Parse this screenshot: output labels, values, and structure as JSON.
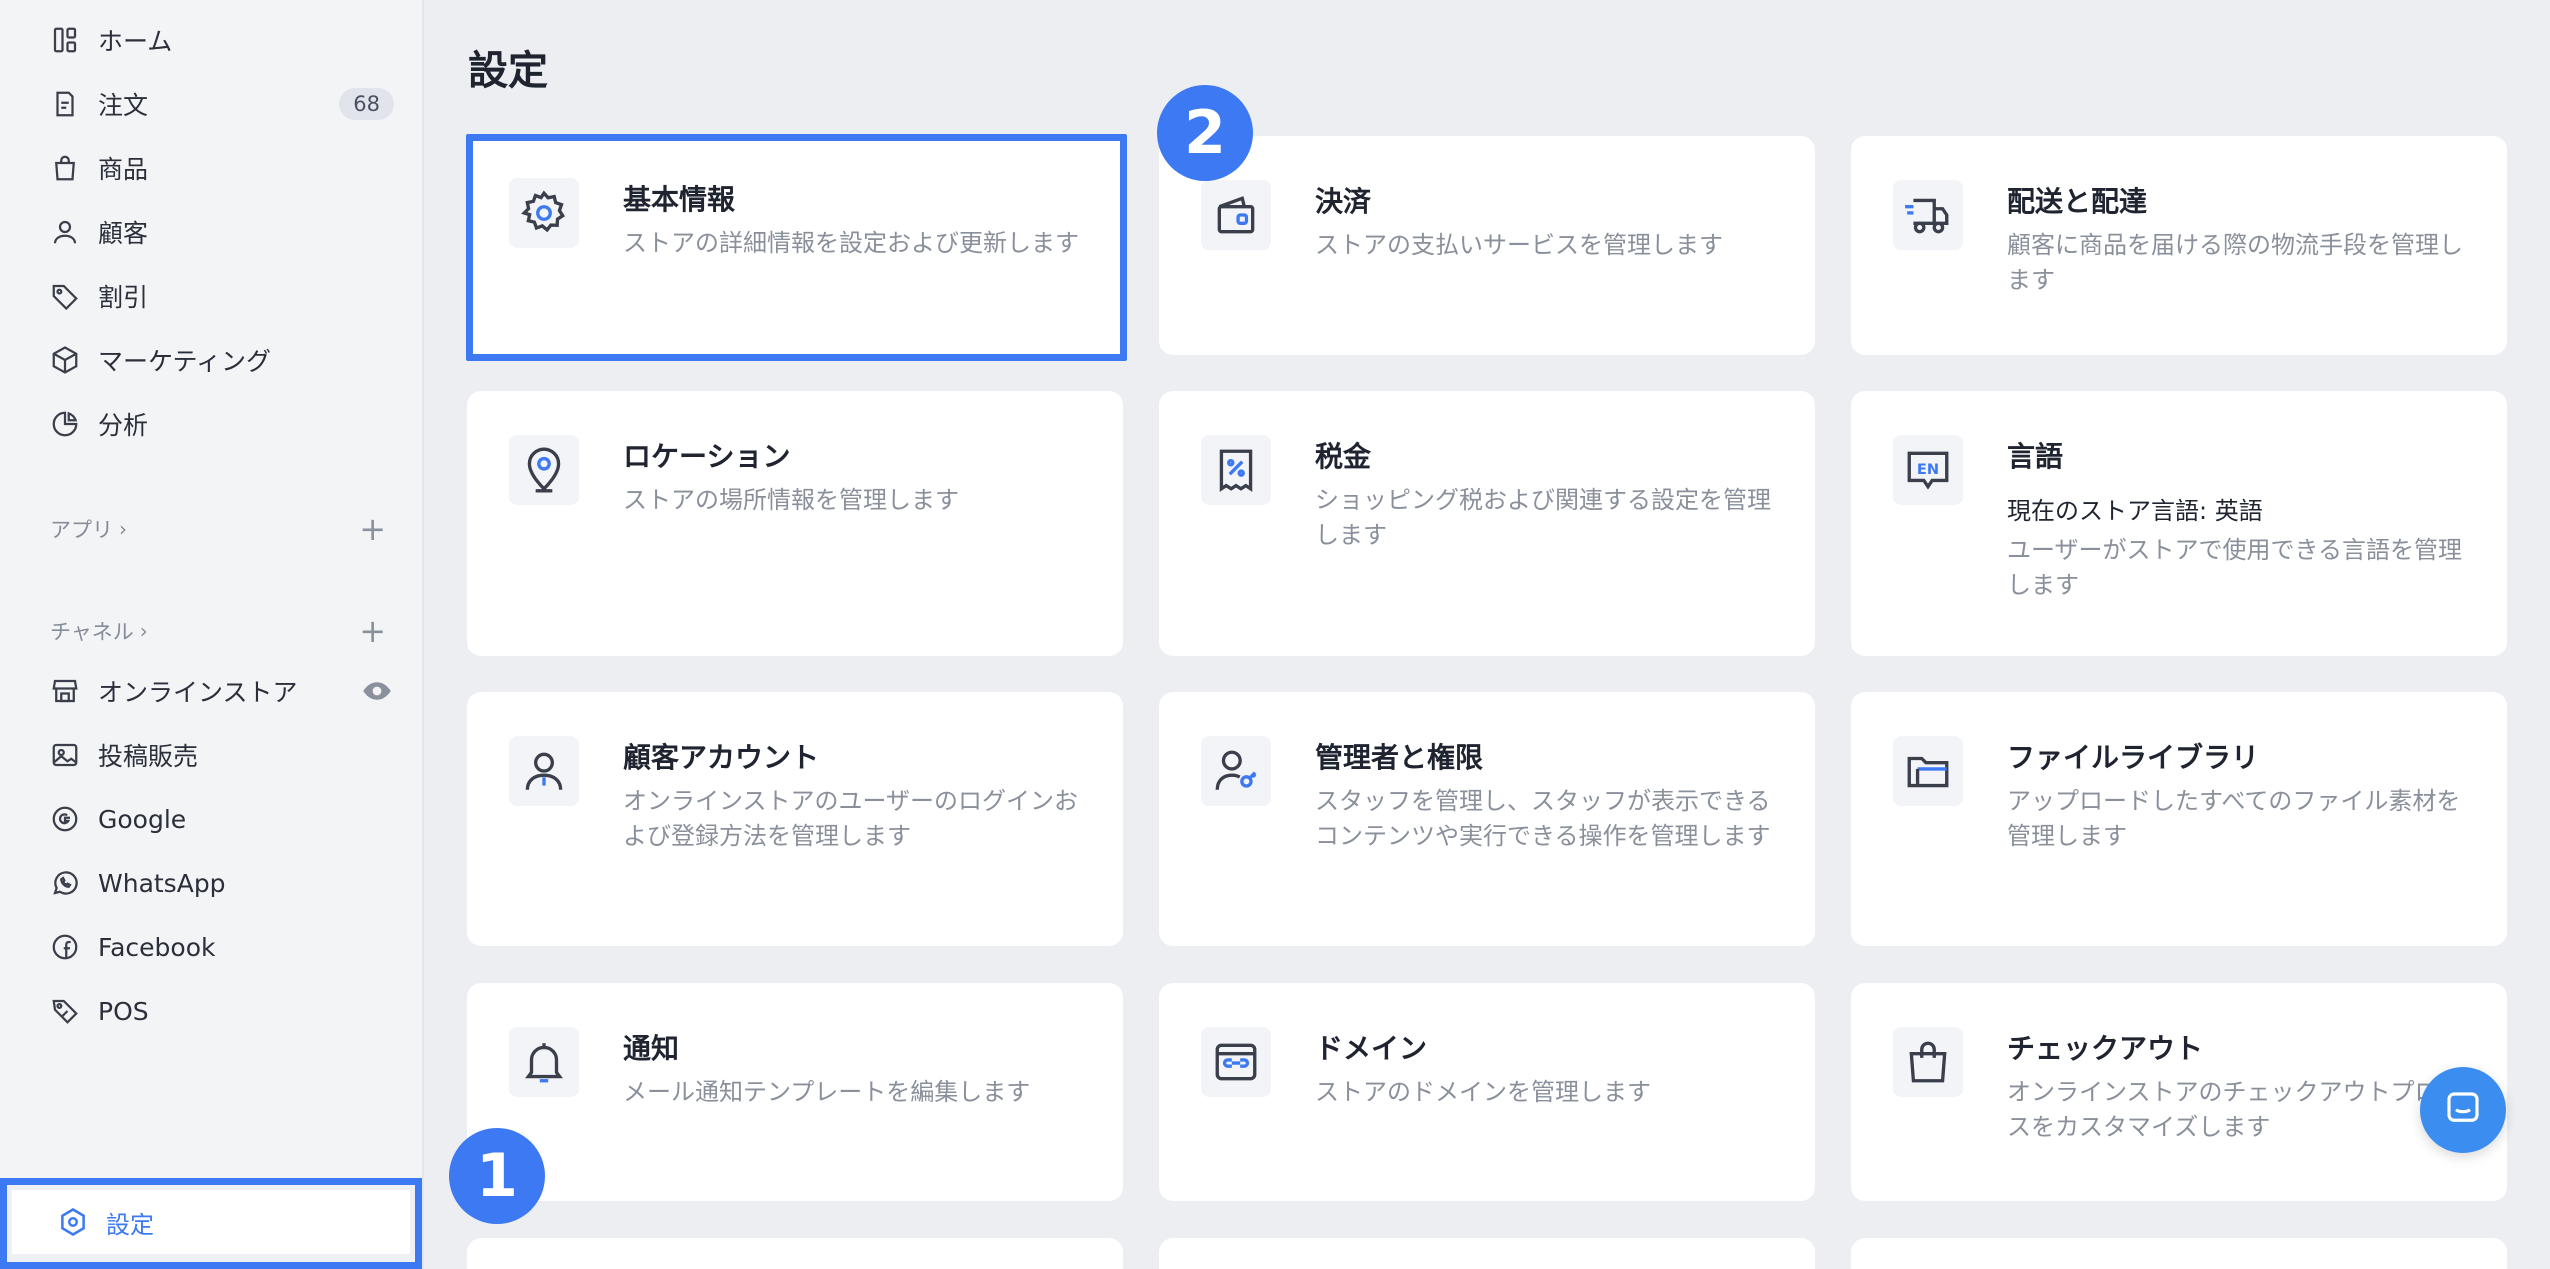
{
  "sidebar": {
    "items": [
      {
        "label": "ホーム",
        "icon": "home-icon"
      },
      {
        "label": "注文",
        "icon": "order-icon",
        "badge": "68"
      },
      {
        "label": "商品",
        "icon": "bag-icon"
      },
      {
        "label": "顧客",
        "icon": "user-icon"
      },
      {
        "label": "割引",
        "icon": "tag-icon"
      },
      {
        "label": "マーケティング",
        "icon": "cube-icon"
      },
      {
        "label": "分析",
        "icon": "pie-chart-icon"
      }
    ],
    "apps_label": "アプリ",
    "channels_label": "チャネル",
    "chevron": "›",
    "plus": "+",
    "channels": [
      {
        "label": "オンラインストア",
        "icon": "store-icon"
      },
      {
        "label": "投稿販売",
        "icon": "image-icon"
      },
      {
        "label": "Google",
        "icon": "google-icon"
      },
      {
        "label": "WhatsApp",
        "icon": "whatsapp-icon"
      },
      {
        "label": "Facebook",
        "icon": "facebook-icon"
      },
      {
        "label": "POS",
        "icon": "pos-icon"
      }
    ],
    "settings_label": "設定"
  },
  "main": {
    "title": "設定",
    "cards": [
      {
        "title": "基本情報",
        "desc": "ストアの詳細情報を設定および更新します",
        "icon": "gear-icon"
      },
      {
        "title": "決済",
        "desc": "ストアの支払いサービスを管理します",
        "icon": "wallet-icon"
      },
      {
        "title": "配送と配達",
        "desc": "顧客に商品を届ける際の物流手段を管理します",
        "icon": "truck-icon"
      },
      {
        "title": "ロケーション",
        "desc": "ストアの場所情報を管理します",
        "icon": "location-pin-icon"
      },
      {
        "title": "税金",
        "desc": "ショッピング税および関連する設定を管理します",
        "icon": "tax-receipt-icon"
      },
      {
        "title": "言語",
        "sub": "現在のストア言語: 英語",
        "desc": "ユーザーがストアで使用できる言語を管理します",
        "icon": "language-en-icon"
      },
      {
        "title": "顧客アカウント",
        "desc": "オンラインストアのユーザーのログインおよび登録方法を管理します",
        "icon": "customer-account-icon"
      },
      {
        "title": "管理者と権限",
        "desc": "スタッフを管理し、スタッフが表示できるコンテンツや実行できる操作を管理します",
        "icon": "admin-key-icon"
      },
      {
        "title": "ファイルライブラリ",
        "desc": "アップロードしたすべてのファイル素材を管理します",
        "icon": "folder-icon"
      },
      {
        "title": "通知",
        "desc": "メール通知テンプレートを編集します",
        "icon": "bell-icon"
      },
      {
        "title": "ドメイン",
        "desc": "ストアのドメインを管理します",
        "icon": "domain-link-icon"
      },
      {
        "title": "チェックアウト",
        "desc": "オンラインストアのチェックアウトプロセスをカスタマイズします",
        "icon": "shopping-bag-icon"
      }
    ]
  },
  "annotations": {
    "step1": "1",
    "step2": "2"
  },
  "colors": {
    "accent": "#3c79f3",
    "background": "#eceef2",
    "card": "#ffffff",
    "muted_text": "#8a909b"
  }
}
